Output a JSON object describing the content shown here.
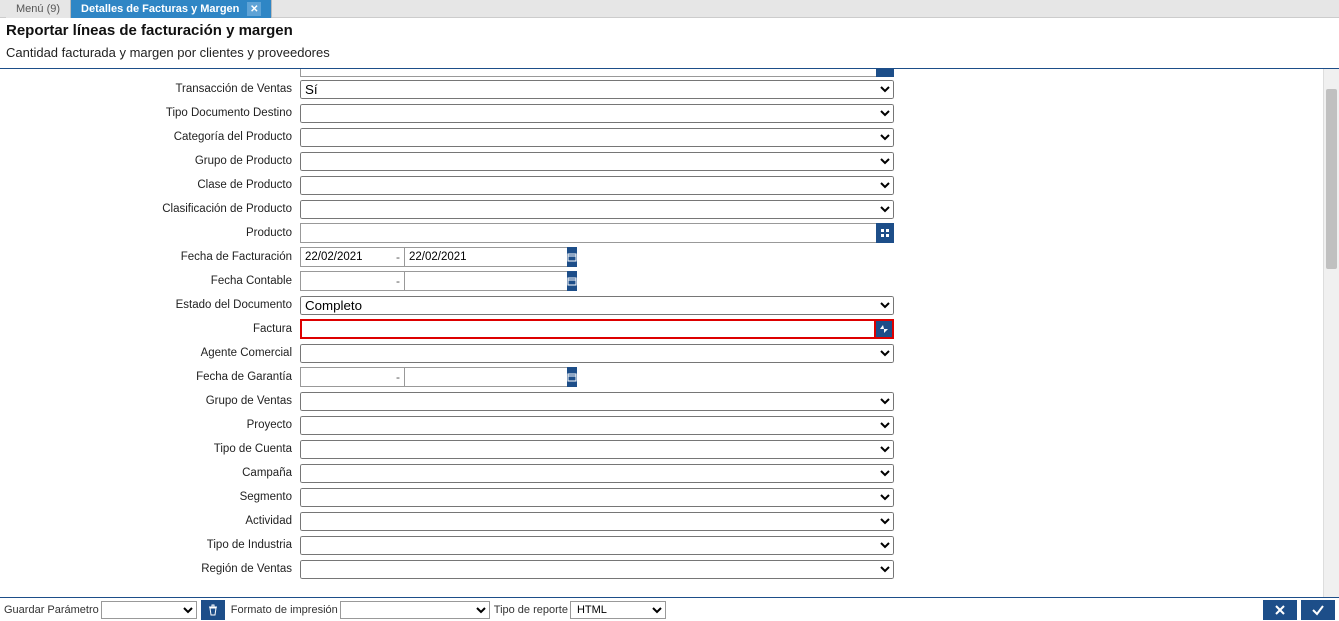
{
  "tabs": {
    "menu": "Menú (9)",
    "active": "Detalles de Facturas y Margen"
  },
  "header": {
    "title": "Reportar líneas de facturación y margen",
    "subtitle": "Cantidad facturada y margen por clientes y proveedores"
  },
  "labels": {
    "trans_ventas": "Transacción de Ventas",
    "tipo_doc_dest": "Tipo Documento Destino",
    "cat_prod": "Categoría del Producto",
    "grupo_prod": "Grupo de Producto",
    "clase_prod": "Clase de Producto",
    "clasif_prod": "Clasificación de Producto",
    "producto": "Producto",
    "fecha_fact": "Fecha de Facturación",
    "fecha_cont": "Fecha Contable",
    "estado_doc": "Estado del Documento",
    "factura": "Factura",
    "agente": "Agente Comercial",
    "fecha_gar": "Fecha de Garantía",
    "grupo_ventas": "Grupo de Ventas",
    "proyecto": "Proyecto",
    "tipo_cuenta": "Tipo de Cuenta",
    "campana": "Campaña",
    "segmento": "Segmento",
    "actividad": "Actividad",
    "tipo_ind": "Tipo de Industria",
    "region_ventas": "Región de Ventas"
  },
  "values": {
    "trans_ventas": "Sí",
    "fecha_fact_from": "22/02/2021",
    "fecha_fact_to": "22/02/2021",
    "estado_doc": "Completo",
    "tipo_reporte": "HTML"
  },
  "footer": {
    "guardar_param": "Guardar Parámetro",
    "formato_imp": "Formato de impresión",
    "tipo_reporte": "Tipo de reporte"
  }
}
